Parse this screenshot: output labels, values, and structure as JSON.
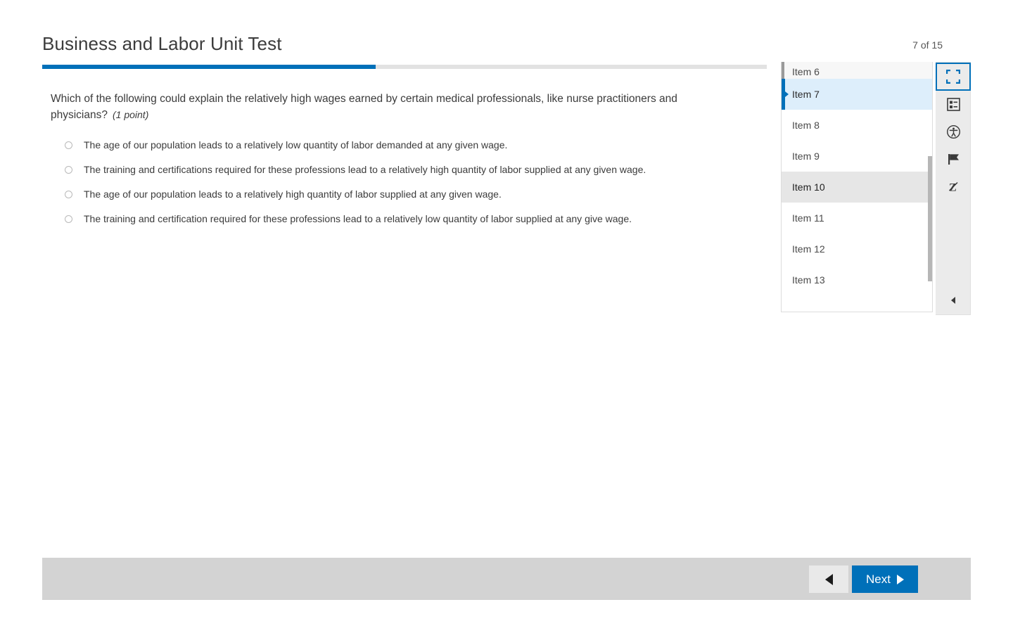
{
  "header": {
    "title": "Business and Labor Unit Test",
    "counter": "7 of 15"
  },
  "progress": {
    "percent": 46,
    "fill_color": "#0070b9",
    "track_color": "#e2e2e2"
  },
  "question": {
    "stem": "Which of the following could explain the relatively high wages earned by certain medical professionals, like nurse practitioners and physicians?",
    "points": "(1 point)",
    "choices": [
      {
        "text": "The age of our population leads to a relatively low quantity of labor demanded at any given wage.",
        "selected": false
      },
      {
        "text": "The training and certifications required for these professions lead to a relatively high quantity of labor supplied at any given wage.",
        "selected": false
      },
      {
        "text": "The age of our population leads to a relatively high quantity of labor supplied at any given wage.",
        "selected": false
      },
      {
        "text": "The training and certification required for these professions lead to a relatively low quantity of labor supplied at any give wage.",
        "selected": false
      }
    ]
  },
  "item_panel": {
    "items": [
      {
        "label": "Item 6",
        "state": "partial"
      },
      {
        "label": "Item 7",
        "state": "selected"
      },
      {
        "label": "Item 8",
        "state": "normal"
      },
      {
        "label": "Item 9",
        "state": "normal"
      },
      {
        "label": "Item 10",
        "state": "hovered"
      },
      {
        "label": "Item 11",
        "state": "normal"
      },
      {
        "label": "Item 12",
        "state": "normal"
      },
      {
        "label": "Item 13",
        "state": "normal"
      }
    ]
  },
  "tool_rail": {
    "buttons": [
      {
        "icon": "fullscreen-icon",
        "name": "fullscreen-button",
        "active": true
      },
      {
        "icon": "item-list-icon",
        "name": "item-list-button",
        "active": false
      },
      {
        "icon": "accessibility-icon",
        "name": "accessibility-button",
        "active": false
      },
      {
        "icon": "flag-icon",
        "name": "flag-button",
        "active": false
      },
      {
        "icon": "strikethrough-z-icon",
        "name": "answer-eliminator-button",
        "active": false
      }
    ],
    "collapse_icon": "chevron-left-icon"
  },
  "bottom_bar": {
    "previous_icon": "triangle-left-icon",
    "next_label": "Next",
    "next_icon": "triangle-right-icon",
    "next_color": "#0070b9"
  }
}
